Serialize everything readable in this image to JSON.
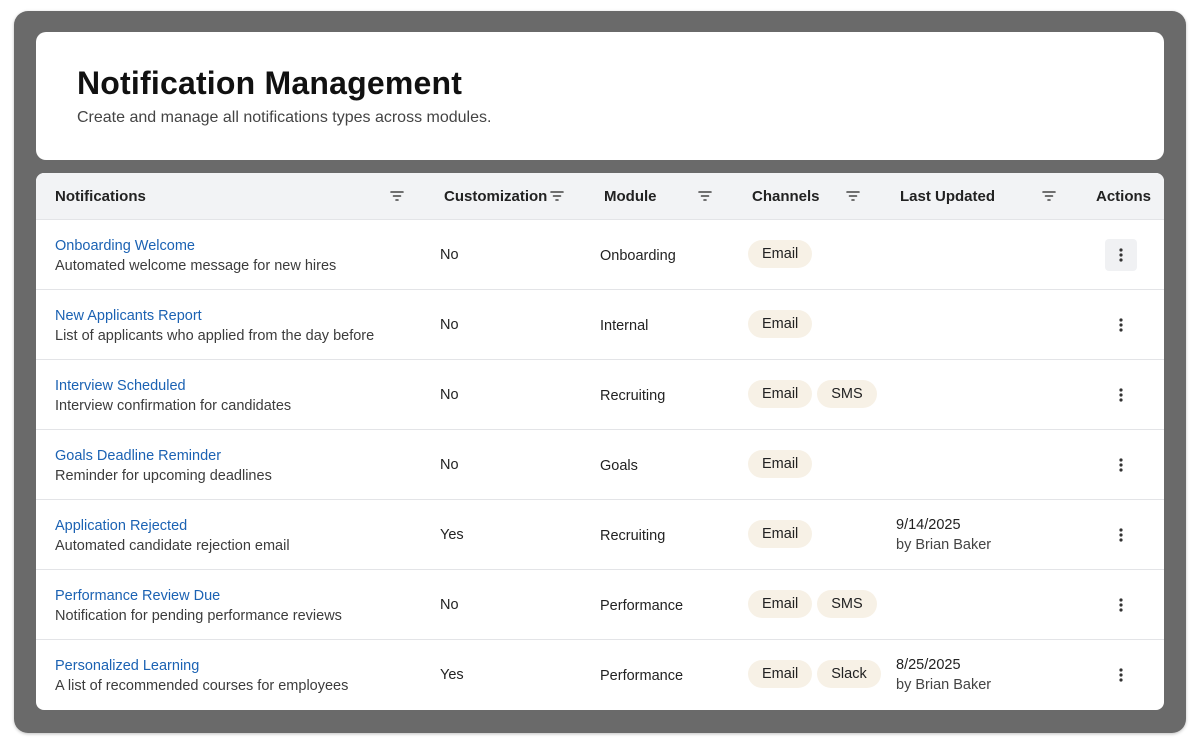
{
  "header": {
    "title": "Notification Management",
    "subtitle": "Create and manage all notifications types across modules."
  },
  "table": {
    "columns": {
      "notifications": "Notifications",
      "customization": "Customization",
      "module": "Module",
      "channels": "Channels",
      "last_updated": "Last Updated",
      "actions": "Actions"
    },
    "rows": [
      {
        "title": "Onboarding Welcome",
        "description": "Automated welcome message for new hires",
        "customization": "No",
        "module": "Onboarding",
        "channels": [
          "Email"
        ],
        "updated_date": "",
        "updated_by": "",
        "action_highlighted": true
      },
      {
        "title": "New Applicants Report",
        "description": "List of applicants who applied from the day before",
        "customization": "No",
        "module": "Internal",
        "channels": [
          "Email"
        ],
        "updated_date": "",
        "updated_by": "",
        "action_highlighted": false
      },
      {
        "title": "Interview Scheduled",
        "description": "Interview confirmation for candidates",
        "customization": "No",
        "module": "Recruiting",
        "channels": [
          "Email",
          "SMS"
        ],
        "updated_date": "",
        "updated_by": "",
        "action_highlighted": false
      },
      {
        "title": "Goals Deadline Reminder",
        "description": "Reminder for upcoming deadlines",
        "customization": "No",
        "module": "Goals",
        "channels": [
          "Email"
        ],
        "updated_date": "",
        "updated_by": "",
        "action_highlighted": false
      },
      {
        "title": "Application Rejected",
        "description": "Automated candidate rejection email",
        "customization": "Yes",
        "module": "Recruiting",
        "channels": [
          "Email"
        ],
        "updated_date": "9/14/2025",
        "updated_by": "by Brian Baker",
        "action_highlighted": false
      },
      {
        "title": "Performance Review Due",
        "description": "Notification for pending performance reviews",
        "customization": "No",
        "module": "Performance",
        "channels": [
          "Email",
          "SMS"
        ],
        "updated_date": "",
        "updated_by": "",
        "action_highlighted": false
      },
      {
        "title": "Personalized Learning",
        "description": "A list of recommended courses for employees",
        "customization": "Yes",
        "module": "Performance",
        "channels": [
          "Email",
          "Slack"
        ],
        "updated_date": "8/25/2025",
        "updated_by": "by Brian Baker",
        "action_highlighted": false
      }
    ]
  },
  "colors": {
    "frame": "#6a6a6a",
    "link": "#1b62b3",
    "chip_bg": "#f7f1e6",
    "header_bg": "#f2f3f5"
  },
  "icons": {
    "filter": "filter-icon",
    "actions": "kebab-menu-icon"
  }
}
